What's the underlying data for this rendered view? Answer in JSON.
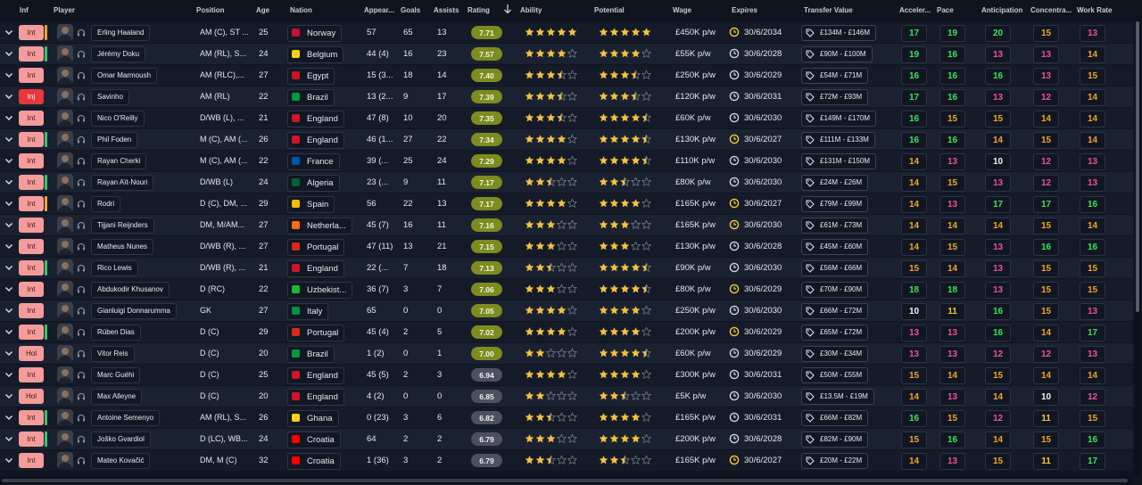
{
  "columns": {
    "inf": "Inf",
    "player": "Player",
    "position": "Position",
    "age": "Age",
    "nation": "Nation",
    "appearances": "Appear...",
    "goals": "Goals",
    "assists": "Assists",
    "rating": "Rating",
    "ability": "Ability",
    "potential": "Potential",
    "wage": "Wage",
    "expires": "Expires",
    "transfer_value": "Transfer Value",
    "acceleration": "Acceler...",
    "pace": "Pace",
    "anticipation": "Anticipation",
    "concentration": "Concentra...",
    "work_rate": "Work Rate"
  },
  "sort": {
    "column": "rating",
    "direction": "descending"
  },
  "colors": {
    "attr_green": "#3ee35a",
    "attr_yellow": "#f3cd35",
    "attr_orange": "#f3a62b",
    "attr_magenta": "#ee4fa6",
    "attr_white": "#f1f2f4",
    "star_gold": "#f2c23c",
    "rating_high": "#7d8b1f",
    "rating_mid": "#4d5060",
    "injury_red": "#e5383b",
    "inf_pink": "#f59b9b"
  },
  "players": [
    {
      "inf": "Int",
      "strip": "o",
      "name": "Erling Haaland",
      "position": "AM (C), ST ...",
      "age": "25",
      "nation": "Norway",
      "flag": "#c8102e",
      "apps": "57",
      "goals": "65",
      "assists": "13",
      "rating": "7.71",
      "ability": 5,
      "potential": 5,
      "wage": "£450K p/w",
      "expires": "30/6/2034",
      "exp_warn": true,
      "value": "£134M - £146M",
      "acc": "17",
      "pace": "19",
      "ant": "20",
      "con": "15",
      "wr": "13",
      "acc_c": "green",
      "pace_c": "green",
      "ant_c": "green",
      "con_c": "orange",
      "wr_c": "magenta"
    },
    {
      "inf": "Int",
      "strip": "g",
      "name": "Jérémy Doku",
      "position": "AM (RL), S...",
      "age": "24",
      "nation": "Belgium",
      "flag": "#f7d117",
      "apps": "44 (4)",
      "goals": "16",
      "assists": "23",
      "rating": "7.57",
      "ability": 4,
      "potential": 4,
      "wage": "£55K p/w",
      "expires": "30/6/2028",
      "exp_warn": false,
      "value": "£90M - £100M",
      "acc": "19",
      "pace": "16",
      "ant": "13",
      "con": "13",
      "wr": "14",
      "acc_c": "green",
      "pace_c": "green",
      "ant_c": "magenta",
      "con_c": "magenta",
      "wr_c": "orange"
    },
    {
      "inf": "Int",
      "strip": "none",
      "name": "Omar Marmoush",
      "position": "AM (RLC),...",
      "age": "27",
      "nation": "Egypt",
      "flag": "#ce1126",
      "apps": "15 (3...",
      "goals": "18",
      "assists": "14",
      "rating": "7.40",
      "ability": 3.5,
      "potential": 3.5,
      "wage": "£250K p/w",
      "expires": "30/6/2029",
      "exp_warn": false,
      "value": "£54M - £71M",
      "acc": "16",
      "pace": "16",
      "ant": "16",
      "con": "13",
      "wr": "15",
      "acc_c": "green",
      "pace_c": "green",
      "ant_c": "green",
      "con_c": "magenta",
      "wr_c": "orange"
    },
    {
      "inf": "Inj",
      "strip": "none",
      "name": "Savinho",
      "position": "AM (RL)",
      "age": "22",
      "nation": "Brazil",
      "flag": "#009c3b",
      "apps": "13 (2...",
      "goals": "9",
      "assists": "17",
      "rating": "7.39",
      "ability": 3.5,
      "potential": 3.5,
      "wage": "£120K p/w",
      "expires": "30/6/2031",
      "exp_warn": false,
      "value": "£72M - £93M",
      "acc": "17",
      "pace": "16",
      "ant": "13",
      "con": "12",
      "wr": "14",
      "acc_c": "green",
      "pace_c": "green",
      "ant_c": "magenta",
      "con_c": "magenta",
      "wr_c": "orange"
    },
    {
      "inf": "Int",
      "strip": "none",
      "name": "Nico O'Reilly",
      "position": "D/WB (L), ...",
      "age": "21",
      "nation": "England",
      "flag": "#cf142b",
      "apps": "47 (8)",
      "goals": "10",
      "assists": "20",
      "rating": "7.35",
      "ability": 3.5,
      "potential": 4.5,
      "wage": "£60K p/w",
      "expires": "30/6/2030",
      "exp_warn": false,
      "value": "£149M - £170M",
      "acc": "16",
      "pace": "15",
      "ant": "15",
      "con": "14",
      "wr": "14",
      "acc_c": "green",
      "pace_c": "orange",
      "ant_c": "orange",
      "con_c": "orange",
      "wr_c": "orange"
    },
    {
      "inf": "Int",
      "strip": "g",
      "name": "Phil Foden",
      "position": "M (C), AM (...",
      "age": "26",
      "nation": "England",
      "flag": "#cf142b",
      "apps": "46 (1...",
      "goals": "27",
      "assists": "22",
      "rating": "7.34",
      "ability": 4,
      "potential": 4.5,
      "wage": "£130K p/w",
      "expires": "30/6/2027",
      "exp_warn": true,
      "value": "£111M - £133M",
      "acc": "16",
      "pace": "16",
      "ant": "14",
      "con": "15",
      "wr": "14",
      "acc_c": "green",
      "pace_c": "green",
      "ant_c": "orange",
      "con_c": "orange",
      "wr_c": "orange"
    },
    {
      "inf": "Int",
      "strip": "none",
      "name": "Rayan Cherki",
      "position": "M (C), AM (...",
      "age": "22",
      "nation": "France",
      "flag": "#0055a4",
      "apps": "39 (...",
      "goals": "25",
      "assists": "24",
      "rating": "7.29",
      "ability": 4,
      "potential": 4.5,
      "wage": "£110K p/w",
      "expires": "30/6/2030",
      "exp_warn": false,
      "value": "£131M - £150M",
      "acc": "14",
      "pace": "13",
      "ant": "10",
      "con": "12",
      "wr": "13",
      "acc_c": "orange",
      "pace_c": "magenta",
      "ant_c": "white",
      "con_c": "magenta",
      "wr_c": "magenta"
    },
    {
      "inf": "Int",
      "strip": "g",
      "name": "Rayan Aït-Nouri",
      "position": "D/WB (L)",
      "age": "24",
      "nation": "Algeria",
      "flag": "#006233",
      "apps": "23 (...",
      "goals": "9",
      "assists": "11",
      "rating": "7.17",
      "ability": 2.5,
      "potential": 2.5,
      "wage": "£80K p/w",
      "expires": "30/6/2030",
      "exp_warn": false,
      "value": "£24M - £26M",
      "acc": "14",
      "pace": "15",
      "ant": "13",
      "con": "12",
      "wr": "13",
      "acc_c": "orange",
      "pace_c": "orange",
      "ant_c": "magenta",
      "con_c": "magenta",
      "wr_c": "magenta"
    },
    {
      "inf": "Int",
      "strip": "o",
      "name": "Rodri",
      "position": "D (C), DM, ...",
      "age": "29",
      "nation": "Spain",
      "flag": "#f1bf00",
      "apps": "56",
      "goals": "22",
      "assists": "13",
      "rating": "7.17",
      "ability": 4,
      "potential": 4,
      "wage": "£165K p/w",
      "expires": "30/6/2027",
      "exp_warn": true,
      "value": "£79M - £99M",
      "acc": "14",
      "pace": "13",
      "ant": "17",
      "con": "17",
      "wr": "16",
      "acc_c": "orange",
      "pace_c": "magenta",
      "ant_c": "green",
      "con_c": "green",
      "wr_c": "green"
    },
    {
      "inf": "Int",
      "strip": "none",
      "name": "Tijjani Reijnders",
      "position": "DM, M/AM...",
      "age": "27",
      "nation": "Netherla...",
      "flag": "#ff6a13",
      "apps": "45 (7)",
      "goals": "16",
      "assists": "11",
      "rating": "7.16",
      "ability": 3,
      "potential": 3,
      "wage": "£165K p/w",
      "expires": "30/6/2030",
      "exp_warn": true,
      "value": "£61M - £73M",
      "acc": "14",
      "pace": "14",
      "ant": "14",
      "con": "15",
      "wr": "14",
      "acc_c": "orange",
      "pace_c": "orange",
      "ant_c": "orange",
      "con_c": "orange",
      "wr_c": "orange"
    },
    {
      "inf": "Int",
      "strip": "none",
      "name": "Matheus Nunes",
      "position": "D/WB (R), ...",
      "age": "27",
      "nation": "Portugal",
      "flag": "#da291c",
      "apps": "47 (11)",
      "goals": "13",
      "assists": "21",
      "rating": "7.15",
      "ability": 3,
      "potential": 3,
      "wage": "£130K p/w",
      "expires": "30/6/2028",
      "exp_warn": false,
      "value": "£45M - £60M",
      "acc": "14",
      "pace": "15",
      "ant": "13",
      "con": "16",
      "wr": "16",
      "acc_c": "orange",
      "pace_c": "orange",
      "ant_c": "magenta",
      "con_c": "green",
      "wr_c": "green"
    },
    {
      "inf": "Int",
      "strip": "g",
      "name": "Rico Lewis",
      "position": "D/WB (R), ...",
      "age": "21",
      "nation": "England",
      "flag": "#cf142b",
      "apps": "22 (...",
      "goals": "7",
      "assists": "18",
      "rating": "7.13",
      "ability": 2.5,
      "potential": 4.5,
      "wage": "£90K p/w",
      "expires": "30/6/2030",
      "exp_warn": false,
      "value": "£56M - £66M",
      "acc": "15",
      "pace": "14",
      "ant": "13",
      "con": "15",
      "wr": "15",
      "acc_c": "orange",
      "pace_c": "orange",
      "ant_c": "magenta",
      "con_c": "orange",
      "wr_c": "orange"
    },
    {
      "inf": "Int",
      "strip": "none",
      "name": "Abdukodir Khusanov",
      "position": "D (RC)",
      "age": "22",
      "nation": "Uzbekist...",
      "flag": "#1eb53a",
      "apps": "36 (7)",
      "goals": "3",
      "assists": "7",
      "rating": "7.06",
      "ability": 3,
      "potential": 4.5,
      "wage": "£80K p/w",
      "expires": "30/6/2029",
      "exp_warn": true,
      "value": "£70M - £90M",
      "acc": "18",
      "pace": "18",
      "ant": "13",
      "con": "15",
      "wr": "15",
      "acc_c": "green",
      "pace_c": "green",
      "ant_c": "magenta",
      "con_c": "orange",
      "wr_c": "orange"
    },
    {
      "inf": "Int",
      "strip": "none",
      "name": "Gianluigi Donnarumma",
      "position": "GK",
      "age": "27",
      "nation": "Italy",
      "flag": "#009246",
      "apps": "65",
      "goals": "0",
      "assists": "0",
      "rating": "7.05",
      "ability": 4,
      "potential": 4,
      "wage": "£250K p/w",
      "expires": "30/6/2030",
      "exp_warn": false,
      "value": "£66M - £72M",
      "acc": "10",
      "pace": "11",
      "ant": "16",
      "con": "15",
      "wr": "13",
      "acc_c": "white",
      "pace_c": "yellow",
      "ant_c": "green",
      "con_c": "orange",
      "wr_c": "magenta"
    },
    {
      "inf": "Int",
      "strip": "g",
      "name": "Rúben Dias",
      "position": "D (C)",
      "age": "29",
      "nation": "Portugal",
      "flag": "#da291c",
      "apps": "45 (4)",
      "goals": "2",
      "assists": "5",
      "rating": "7.02",
      "ability": 4,
      "potential": 4,
      "wage": "£200K p/w",
      "expires": "30/6/2029",
      "exp_warn": true,
      "value": "£65M - £72M",
      "acc": "13",
      "pace": "13",
      "ant": "16",
      "con": "14",
      "wr": "17",
      "acc_c": "magenta",
      "pace_c": "magenta",
      "ant_c": "green",
      "con_c": "orange",
      "wr_c": "green"
    },
    {
      "inf": "Hol",
      "strip": "none",
      "name": "Vitor Reis",
      "position": "D (C)",
      "age": "20",
      "nation": "Brazil",
      "flag": "#009c3b",
      "apps": "1 (2)",
      "goals": "0",
      "assists": "1",
      "rating": "7.00",
      "ability": 2,
      "potential": 4.5,
      "wage": "£60K p/w",
      "expires": "30/6/2029",
      "exp_warn": false,
      "value": "£30M - £34M",
      "acc": "13",
      "pace": "13",
      "ant": "12",
      "con": "12",
      "wr": "13",
      "acc_c": "magenta",
      "pace_c": "magenta",
      "ant_c": "magenta",
      "con_c": "magenta",
      "wr_c": "magenta"
    },
    {
      "inf": "Int",
      "strip": "none",
      "name": "Marc Guéhi",
      "position": "D (C)",
      "age": "25",
      "nation": "England",
      "flag": "#cf142b",
      "apps": "45 (5)",
      "goals": "2",
      "assists": "3",
      "rating": "6.94",
      "ability": 4,
      "potential": 4,
      "wage": "£300K p/w",
      "expires": "30/6/2031",
      "exp_warn": false,
      "value": "£50M - £55M",
      "acc": "15",
      "pace": "14",
      "ant": "15",
      "con": "14",
      "wr": "14",
      "acc_c": "orange",
      "pace_c": "orange",
      "ant_c": "orange",
      "con_c": "orange",
      "wr_c": "orange"
    },
    {
      "inf": "Hol",
      "strip": "none",
      "name": "Max Alleyne",
      "position": "D (C)",
      "age": "20",
      "nation": "England",
      "flag": "#cf142b",
      "apps": "4 (2)",
      "goals": "0",
      "assists": "0",
      "rating": "6.85",
      "ability": 2,
      "potential": 2.5,
      "wage": "£5K p/w",
      "expires": "30/6/2030",
      "exp_warn": false,
      "value": "£13.5M - £19M",
      "acc": "14",
      "pace": "13",
      "ant": "14",
      "con": "10",
      "wr": "12",
      "acc_c": "orange",
      "pace_c": "magenta",
      "ant_c": "orange",
      "con_c": "white",
      "wr_c": "magenta"
    },
    {
      "inf": "Int",
      "strip": "g",
      "name": "Antoine Semenyo",
      "position": "AM (RL), S...",
      "age": "26",
      "nation": "Ghana",
      "flag": "#fcd116",
      "apps": "0 (23)",
      "goals": "3",
      "assists": "6",
      "rating": "6.82",
      "ability": 2.5,
      "potential": 4,
      "wage": "£165K p/w",
      "expires": "30/6/2031",
      "exp_warn": false,
      "value": "£66M - £82M",
      "acc": "16",
      "pace": "15",
      "ant": "12",
      "con": "11",
      "wr": "15",
      "acc_c": "green",
      "pace_c": "orange",
      "ant_c": "magenta",
      "con_c": "yellow",
      "wr_c": "orange"
    },
    {
      "inf": "Int",
      "strip": "g",
      "name": "Joško Gvardiol",
      "position": "D (LC), WB...",
      "age": "24",
      "nation": "Croatia",
      "flag": "#ff0000",
      "apps": "64",
      "goals": "2",
      "assists": "2",
      "rating": "6.79",
      "ability": 3,
      "potential": 4,
      "wage": "£200K p/w",
      "expires": "30/6/2028",
      "exp_warn": false,
      "value": "£82M - £90M",
      "acc": "15",
      "pace": "16",
      "ant": "14",
      "con": "15",
      "wr": "16",
      "acc_c": "orange",
      "pace_c": "green",
      "ant_c": "orange",
      "con_c": "orange",
      "wr_c": "green"
    },
    {
      "inf": "Int",
      "strip": "none",
      "name": "Mateo Kovačić",
      "position": "DM, M (C)",
      "age": "32",
      "nation": "Croatia",
      "flag": "#ff0000",
      "apps": "1 (36)",
      "goals": "3",
      "assists": "2",
      "rating": "6.79",
      "ability": 2.5,
      "potential": 2.5,
      "wage": "£165K p/w",
      "expires": "30/6/2027",
      "exp_warn": true,
      "value": "£20M - £22M",
      "acc": "14",
      "pace": "13",
      "ant": "15",
      "con": "11",
      "wr": "17",
      "acc_c": "orange",
      "pace_c": "magenta",
      "ant_c": "orange",
      "con_c": "yellow",
      "wr_c": "green"
    }
  ]
}
